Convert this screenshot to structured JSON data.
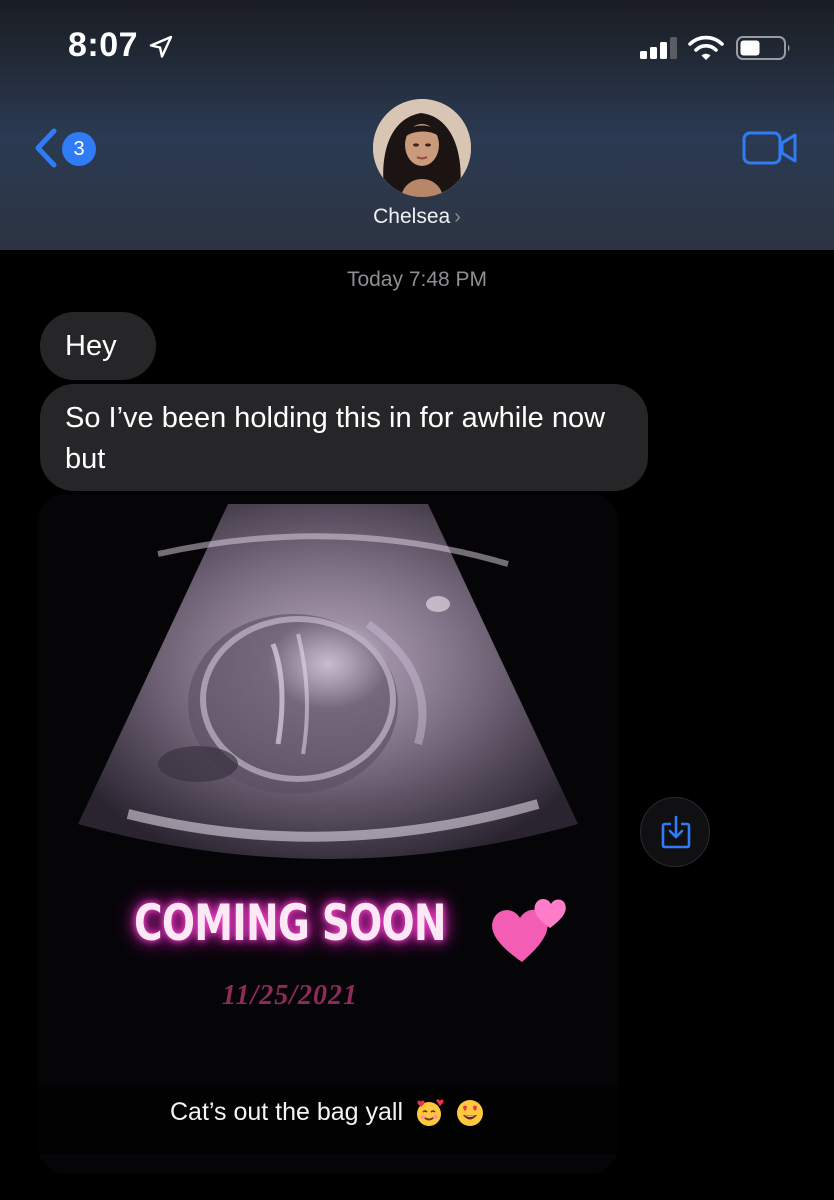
{
  "status_bar": {
    "time": "8:07",
    "location_icon": "location-arrow-icon",
    "signal_icon": "cellular-signal-icon",
    "wifi_icon": "wifi-icon",
    "battery_icon": "battery-icon"
  },
  "header": {
    "back_badge_count": "3",
    "back_icon": "chevron-left-icon",
    "contact_name": "Chelsea",
    "name_chevron": "›",
    "video_icon": "video-camera-icon",
    "accent_color": "#2f7cf6"
  },
  "conversation": {
    "timestamp": "Today 7:48 PM",
    "messages": [
      {
        "sender": "Chelsea",
        "text": "Hey"
      },
      {
        "sender": "Chelsea",
        "text": "So I’ve been holding this in for awhile now but"
      }
    ],
    "image_message": {
      "headline": "COMING SOON",
      "date": "11/25/2021",
      "caption": "Cat’s out the bag yall",
      "caption_emojis": [
        "smiling-face-with-hearts-icon",
        "heart-eyes-icon"
      ],
      "hearts_icon": "two-hearts-icon",
      "download_icon": "download-icon"
    }
  }
}
